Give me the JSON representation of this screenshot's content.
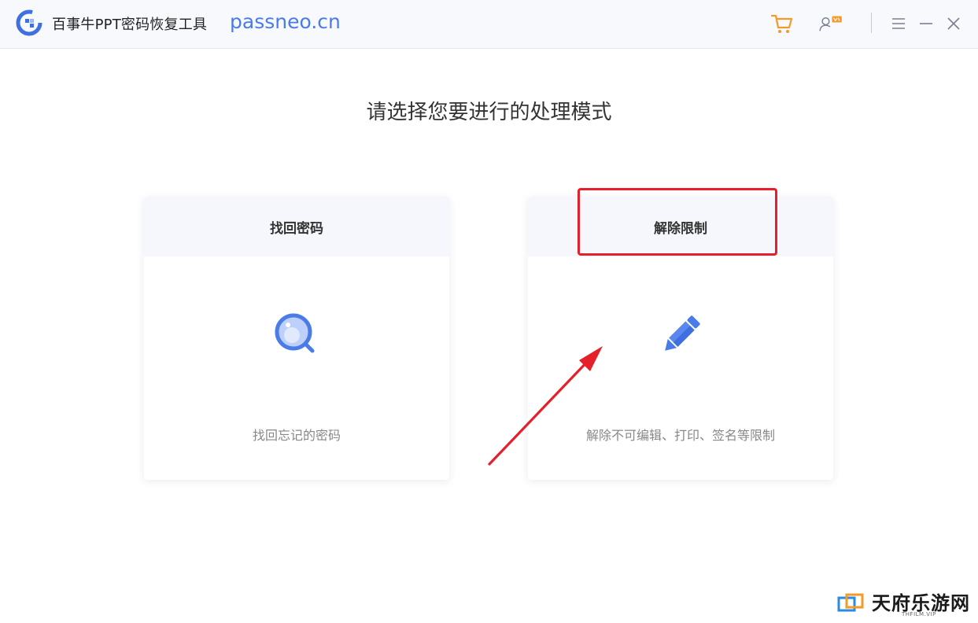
{
  "titlebar": {
    "app_title": "百事牛PPT密码恢复工具",
    "app_url": "passneo.cn",
    "logo_icon": "app-logo-icon",
    "cart_icon": "cart-icon",
    "account_icon": "user-vip-icon",
    "menu_icon": "menu-icon",
    "minimize_icon": "minimize-icon",
    "close_icon": "close-icon",
    "accent": "#4a7be8",
    "cart_color": "#f39a2b"
  },
  "main": {
    "heading": "请选择您要进行的处理模式",
    "cards": [
      {
        "title": "找回密码",
        "icon": "magnifier-icon",
        "description": "找回忘记的密码"
      },
      {
        "title": "解除限制",
        "icon": "pencil-icon",
        "description": "解除不可编辑、打印、签名等限制"
      }
    ]
  },
  "annotation": {
    "highlight_color": "#e5202a"
  },
  "watermark": {
    "text": "天府乐游网",
    "sub": "THFILM.VIP"
  }
}
